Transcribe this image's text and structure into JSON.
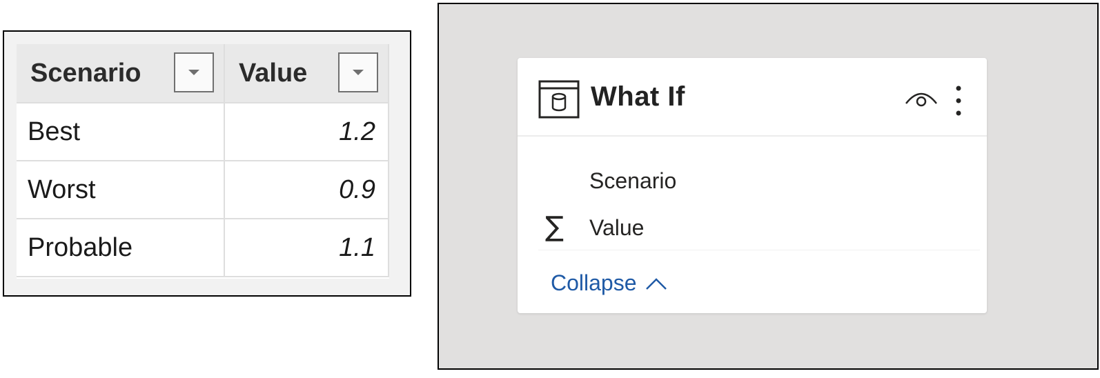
{
  "table": {
    "headers": [
      "Scenario",
      "Value"
    ],
    "rows": [
      {
        "scenario": "Best",
        "value": "1.2"
      },
      {
        "scenario": "Worst",
        "value": "0.9"
      },
      {
        "scenario": "Probable",
        "value": "1.1"
      }
    ],
    "filter_icon": "dropdown-arrow-icon"
  },
  "panel": {
    "title": "What If",
    "title_icon": "table-icon",
    "header_icons": [
      "eye-icon",
      "more-options-icon"
    ],
    "fields": [
      {
        "label": "Scenario",
        "icon": ""
      },
      {
        "label": "Value",
        "icon": "sigma-icon",
        "glyph": "∑"
      }
    ],
    "collapse_label": "Collapse",
    "collapse_icon": "chevron-up-icon",
    "link_color": "#1f5aa6",
    "background": "#e1e0df"
  }
}
